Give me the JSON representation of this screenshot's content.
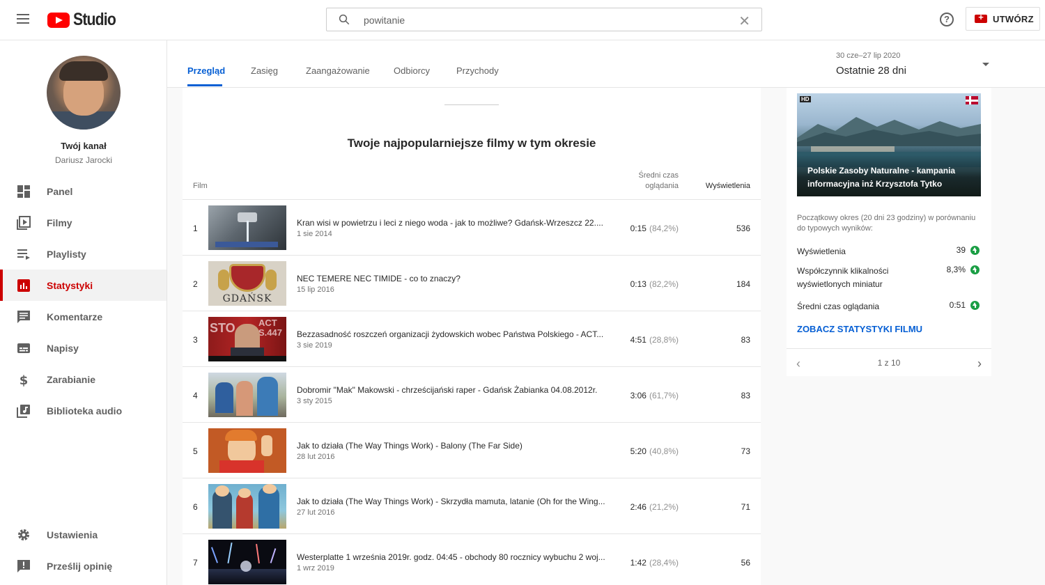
{
  "header": {
    "logo_text": "Studio",
    "search_value": "powitanie",
    "create_label": "UTWÓRZ"
  },
  "sidebar": {
    "channel_title": "Twój kanał",
    "channel_name": "Dariusz Jarocki",
    "items": [
      {
        "label": "Panel",
        "icon": "dashboard-icon"
      },
      {
        "label": "Filmy",
        "icon": "videos-icon"
      },
      {
        "label": "Playlisty",
        "icon": "playlists-icon"
      },
      {
        "label": "Statystyki",
        "icon": "analytics-icon",
        "active": true
      },
      {
        "label": "Komentarze",
        "icon": "comments-icon"
      },
      {
        "label": "Napisy",
        "icon": "subtitles-icon"
      },
      {
        "label": "Zarabianie",
        "icon": "dollar-icon"
      },
      {
        "label": "Biblioteka audio",
        "icon": "audio-library-icon"
      }
    ],
    "bottom_items": [
      {
        "label": "Ustawienia",
        "icon": "gear-icon"
      },
      {
        "label": "Prześlij opinię",
        "icon": "feedback-icon"
      }
    ]
  },
  "tabs": [
    {
      "label": "Przegląd",
      "active": true
    },
    {
      "label": "Zasięg"
    },
    {
      "label": "Zaangażowanie"
    },
    {
      "label": "Odbiorcy"
    },
    {
      "label": "Przychody"
    }
  ],
  "range": {
    "dates": "30 cze–27 lip 2020",
    "label": "Ostatnie 28 dni"
  },
  "top_videos": {
    "heading": "Twoje najpopularniejsze filmy w tym okresie",
    "col_film": "Film",
    "col_avg": "Średni czas oglądania",
    "col_views": "Wyświetlenia",
    "rows": [
      {
        "rank": "1",
        "title": "Kran wisi w powietrzu i leci z niego woda - jak to możliwe? Gdańsk-Wrzeszcz 22....",
        "date": "1 sie 2014",
        "avg": "0:15",
        "pct": "(84,2%)",
        "views": "536"
      },
      {
        "rank": "2",
        "title": "NEC TEMERE NEC TIMIDE - co to znaczy?",
        "date": "15 lip 2016",
        "avg": "0:13",
        "pct": "(82,2%)",
        "views": "184"
      },
      {
        "rank": "3",
        "title": "Bezzasadność roszczeń organizacji żydowskich wobec Państwa Polskiego - ACT...",
        "date": "3 sie 2019",
        "avg": "4:51",
        "pct": "(28,8%)",
        "views": "83"
      },
      {
        "rank": "4",
        "title": "Dobromir \"Mak\" Makowski - chrześcijański raper - Gdańsk Żabianka 04.08.2012r.",
        "date": "3 sty 2015",
        "avg": "3:06",
        "pct": "(61,7%)",
        "views": "83"
      },
      {
        "rank": "5",
        "title": "Jak to działa (The Way Things Work) - Balony (The Far Side)",
        "date": "28 lut 2016",
        "avg": "5:20",
        "pct": "(40,8%)",
        "views": "73"
      },
      {
        "rank": "6",
        "title": "Jak to działa (The Way Things Work) - Skrzydła mamuta, latanie (Oh for the Wing...",
        "date": "27 lut 2016",
        "avg": "2:46",
        "pct": "(21,2%)",
        "views": "71"
      },
      {
        "rank": "7",
        "title": "Westerplatte 1 września 2019r. godz. 04:45 - obchody 80 rocznicy wybuchu 2 woj...",
        "date": "1 wrz 2019",
        "avg": "1:42",
        "pct": "(28,4%)",
        "views": "56"
      }
    ]
  },
  "side_card": {
    "video_title": "Polskie Zasoby Naturalne - kampania informacyjna inż Krzysztofa Tytko",
    "hd_badge": "HD",
    "note": "Początkowy okres (20 dni 23 godziny) w porównaniu do typowych wyników:",
    "metrics": [
      {
        "label": "Wyświetlenia",
        "value": "39"
      },
      {
        "label": "Współczynnik klikalności wyświetlonych miniatur",
        "value": "8,3%"
      },
      {
        "label": "Średni czas oglądania",
        "value": "0:51"
      }
    ],
    "link": "ZOBACZ STATYSTYKI FILMU",
    "pager": "1 z 10"
  },
  "colors": {
    "accent_red": "#cc0000",
    "link_blue": "#065fd4",
    "trend_green": "#1a9e44"
  }
}
